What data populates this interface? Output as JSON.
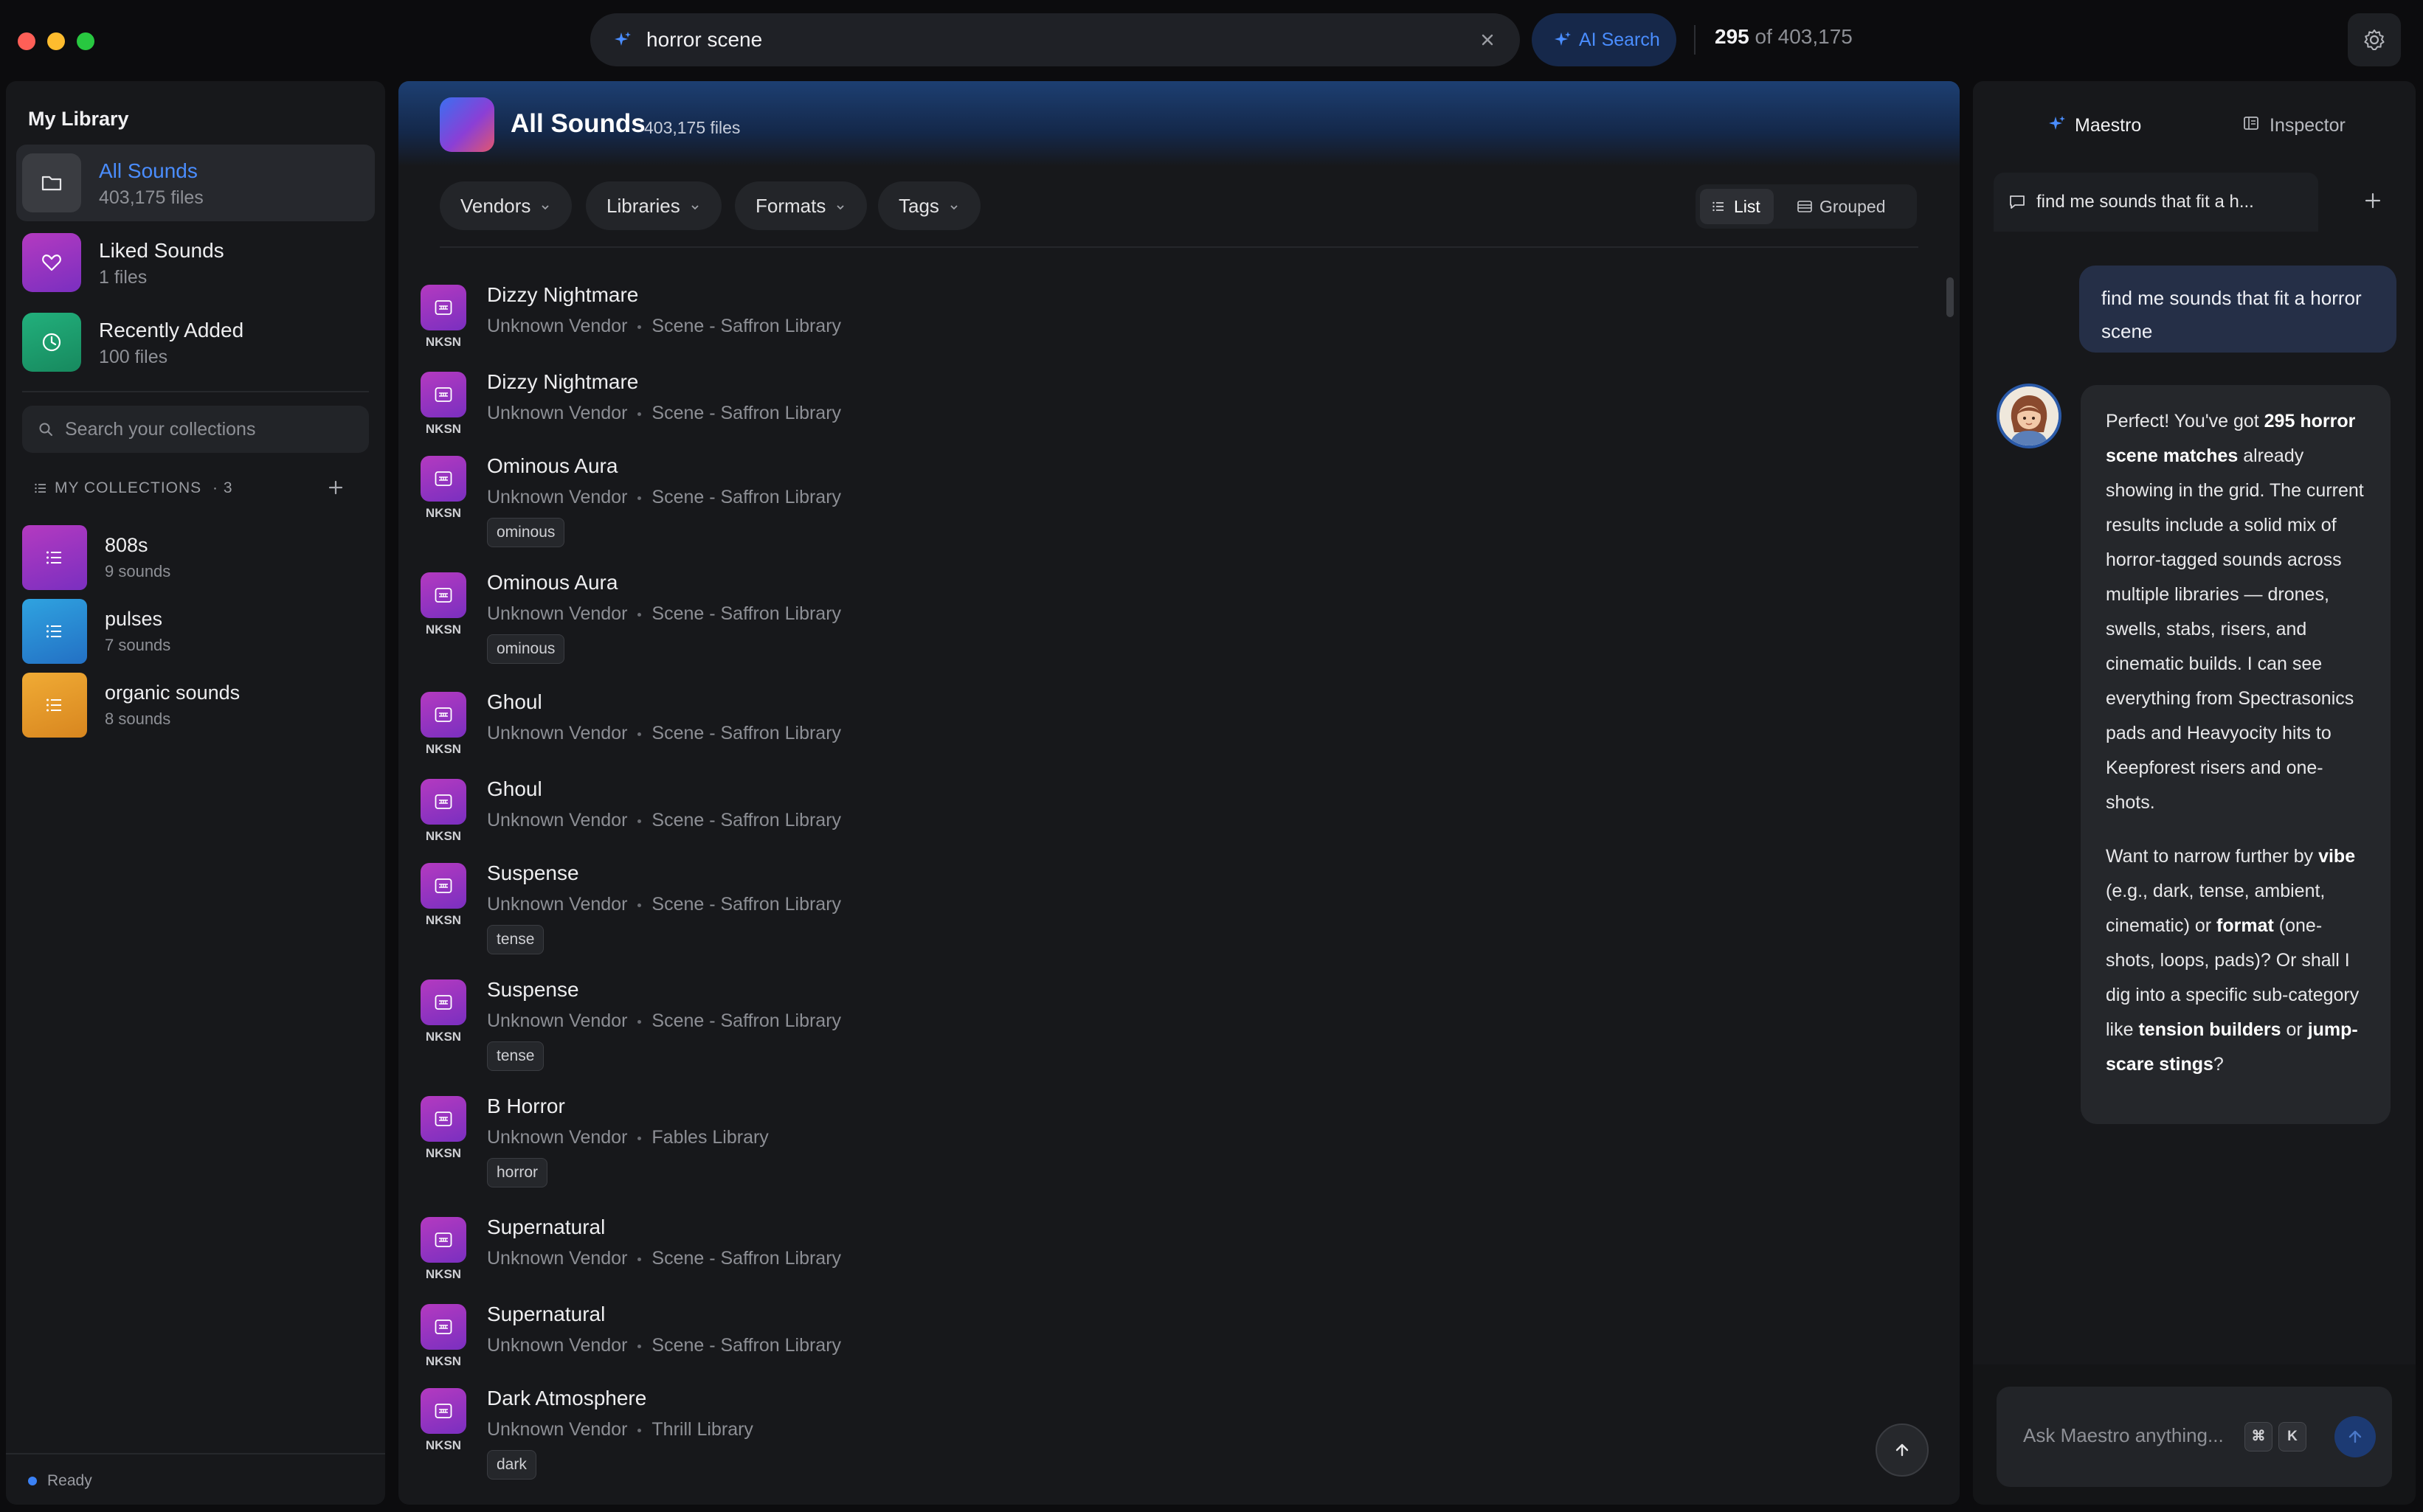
{
  "window": {
    "traffic_lights": {
      "close": "#fe5f57",
      "minimize": "#febc2e",
      "zoom": "#28c840"
    }
  },
  "search": {
    "query": "horror scene",
    "ai_button": "AI Search",
    "count_shown": "295",
    "count_of": "of",
    "count_total": "403,175"
  },
  "sidebar": {
    "title": "My Library",
    "library": [
      {
        "name": "All Sounds",
        "sub": "403,175 files",
        "icon": "folder-icon",
        "color": "#3a3c41"
      },
      {
        "name": "Liked Sounds",
        "sub": "1 files",
        "icon": "heart-icon",
        "color": "#a63cc7"
      },
      {
        "name": "Recently Added",
        "sub": "100 files",
        "icon": "clock-icon",
        "color": "#1f9e6d"
      }
    ],
    "collections_search_placeholder": "Search your collections",
    "collections_header": "MY COLLECTIONS",
    "collections_count": "· 3",
    "collections": [
      {
        "name": "808s",
        "sub": "9 sounds",
        "icon": "list-icon",
        "color": "#9b3bc7"
      },
      {
        "name": "pulses",
        "sub": "7 sounds",
        "icon": "list-icon",
        "color": "#2b8fd6"
      },
      {
        "name": "organic sounds",
        "sub": "8 sounds",
        "icon": "list-icon",
        "color": "#e39a2a"
      }
    ],
    "status": "Ready"
  },
  "main": {
    "title": "All Sounds",
    "subtitle": "403,175 files",
    "filters": [
      "Vendors",
      "Libraries",
      "Formats",
      "Tags"
    ],
    "view_list": "List",
    "view_grouped": "Grouped",
    "rows": [
      {
        "name": "Dizzy Nightmare",
        "vendor": "Unknown Vendor",
        "library": "Scene - Saffron Library",
        "format": "NKSN",
        "tag": ""
      },
      {
        "name": "Dizzy Nightmare",
        "vendor": "Unknown Vendor",
        "library": "Scene - Saffron Library",
        "format": "NKSN",
        "tag": ""
      },
      {
        "name": "Ominous Aura",
        "vendor": "Unknown Vendor",
        "library": "Scene - Saffron Library",
        "format": "NKSN",
        "tag": "ominous"
      },
      {
        "name": "Ominous Aura",
        "vendor": "Unknown Vendor",
        "library": "Scene - Saffron Library",
        "format": "NKSN",
        "tag": "ominous"
      },
      {
        "name": "Ghoul",
        "vendor": "Unknown Vendor",
        "library": "Scene - Saffron Library",
        "format": "NKSN",
        "tag": ""
      },
      {
        "name": "Ghoul",
        "vendor": "Unknown Vendor",
        "library": "Scene - Saffron Library",
        "format": "NKSN",
        "tag": ""
      },
      {
        "name": "Suspense",
        "vendor": "Unknown Vendor",
        "library": "Scene - Saffron Library",
        "format": "NKSN",
        "tag": "tense"
      },
      {
        "name": "Suspense",
        "vendor": "Unknown Vendor",
        "library": "Scene - Saffron Library",
        "format": "NKSN",
        "tag": "tense"
      },
      {
        "name": "B Horror",
        "vendor": "Unknown Vendor",
        "library": "Fables Library",
        "format": "NKSN",
        "tag": "horror"
      },
      {
        "name": "Supernatural",
        "vendor": "Unknown Vendor",
        "library": "Scene - Saffron Library",
        "format": "NKSN",
        "tag": ""
      },
      {
        "name": "Supernatural",
        "vendor": "Unknown Vendor",
        "library": "Scene - Saffron Library",
        "format": "NKSN",
        "tag": ""
      },
      {
        "name": "Dark Atmosphere",
        "vendor": "Unknown Vendor",
        "library": "Thrill Library",
        "format": "NKSN",
        "tag": "dark"
      }
    ]
  },
  "assistant": {
    "tab_maestro": "Maestro",
    "tab_inspector": "Inspector",
    "chat_title": "find me sounds that fit a h...",
    "user_message": "find me sounds that fit a horror scene",
    "reply": {
      "p1_a": "Perfect! You've got ",
      "p1_b": "295 horror scene matches",
      "p1_c": " already showing in the grid. The current results include a solid mix of horror-tagged sounds across multiple libraries — drones, swells, stabs, risers, and cinematic builds. I can see everything from Spectrasonics pads and Heavyocity hits to Keepforest risers and one-shots.",
      "p2_a": "Want to narrow further by ",
      "p2_b": "vibe",
      "p2_c": " (e.g., dark, tense, ambient, cinematic) or ",
      "p2_d": "format",
      "p2_e": " (one-shots, loops, pads)? Or shall I dig into a specific sub-category like ",
      "p2_f": "tension builders",
      "p2_g": " or ",
      "p2_h": "jump-scare stings",
      "p2_i": "?"
    },
    "input_placeholder": "Ask Maestro anything...",
    "shortcut_cmd": "⌘",
    "shortcut_key": "K"
  }
}
